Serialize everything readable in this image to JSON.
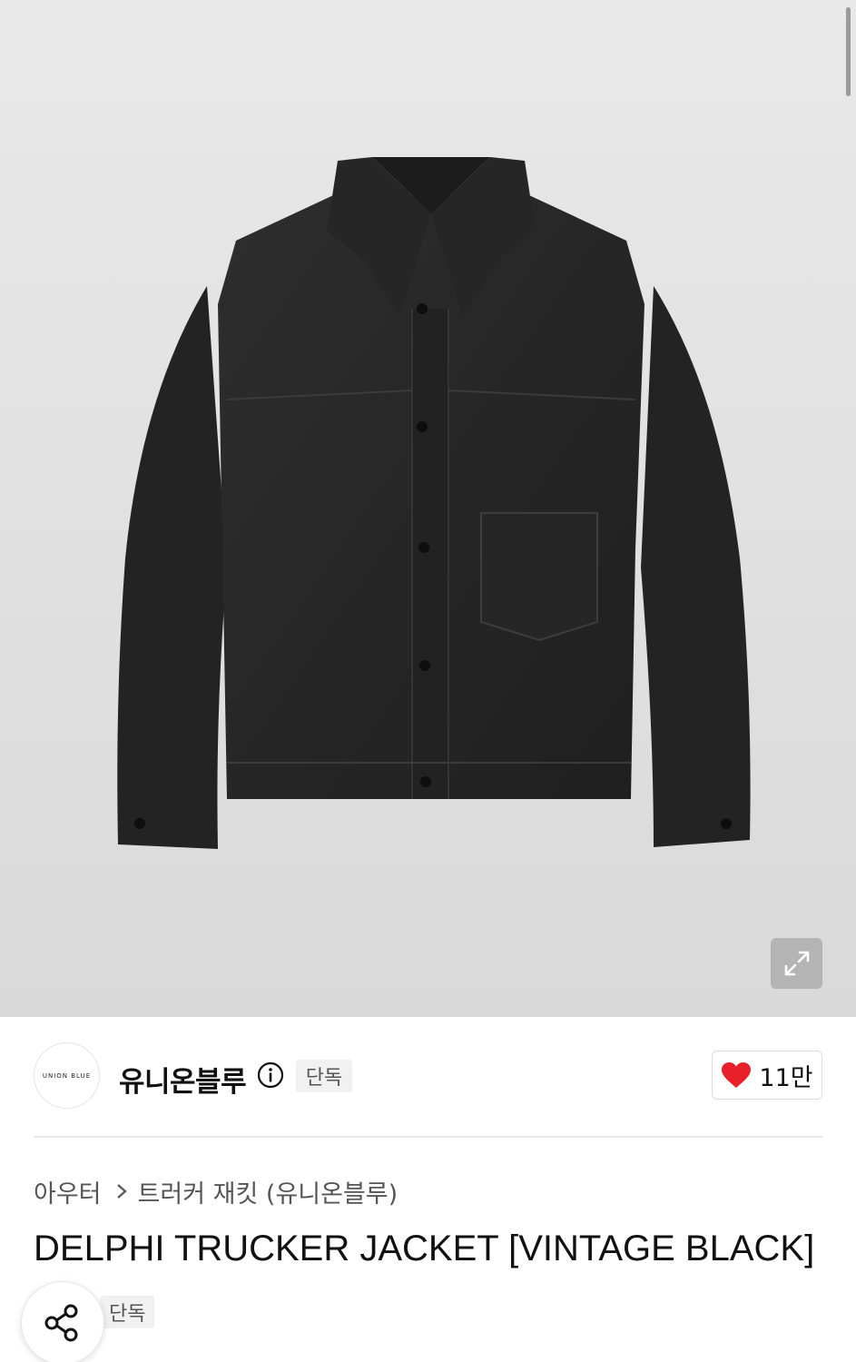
{
  "product": {
    "image_alt": "DELPHI TRUCKER JACKET [VINTAGE BLACK]",
    "title": "DELPHI TRUCKER JACKET [VINTAGE BLACK]"
  },
  "brand": {
    "logo_text": "UNION BLUE",
    "name": "유니온블루",
    "badge": "단독"
  },
  "like": {
    "count": "11만",
    "heart_color": "#e8202a"
  },
  "breadcrumb": {
    "category": "아우터",
    "subcategory": "트러커 재킷 (유니온블루)"
  },
  "tags": {
    "exclusive": "단독"
  },
  "icons": {
    "expand": "expand-icon",
    "info": "info-icon",
    "heart": "heart-icon",
    "share": "share-icon",
    "chevron": "chevron-right-icon"
  }
}
